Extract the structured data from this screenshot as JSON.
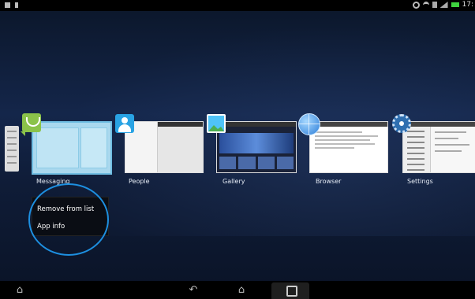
{
  "status_bar": {
    "clock": "17:"
  },
  "recent_apps": [
    {
      "label": "Messaging",
      "icon": "messaging-icon"
    },
    {
      "label": "People",
      "icon": "people-icon"
    },
    {
      "label": "Gallery",
      "icon": "gallery-icon"
    },
    {
      "label": "Browser",
      "icon": "browser-icon"
    },
    {
      "label": "Settings",
      "icon": "settings-icon"
    }
  ],
  "context_menu": {
    "remove_label": "Remove from list",
    "app_info_label": "App info"
  },
  "nav_bar": {
    "icons": [
      "home-outline-icon",
      "back-icon",
      "home-icon",
      "recent-apps-icon"
    ]
  },
  "colors": {
    "highlight_ring": "#1d8fe0",
    "accent_blue": "#29a3e4"
  }
}
